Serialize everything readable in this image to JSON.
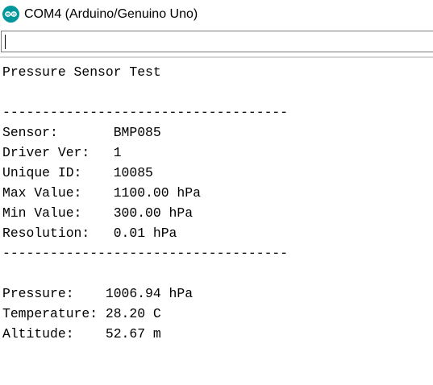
{
  "window": {
    "title": "COM4 (Arduino/Genuino Uno)",
    "icon": "arduino-logo-icon",
    "accent_color": "#00979c"
  },
  "input": {
    "value": "",
    "placeholder": ""
  },
  "output": {
    "lines": [
      "Pressure Sensor Test",
      "",
      "------------------------------------",
      "Sensor:       BMP085",
      "Driver Ver:   1",
      "Unique ID:    10085",
      "Max Value:    1100.00 hPa",
      "Min Value:    300.00 hPa",
      "Resolution:   0.01 hPa",
      "------------------------------------",
      "",
      "Pressure:    1006.94 hPa",
      "Temperature: 28.20 C",
      "Altitude:    52.67 m"
    ]
  }
}
